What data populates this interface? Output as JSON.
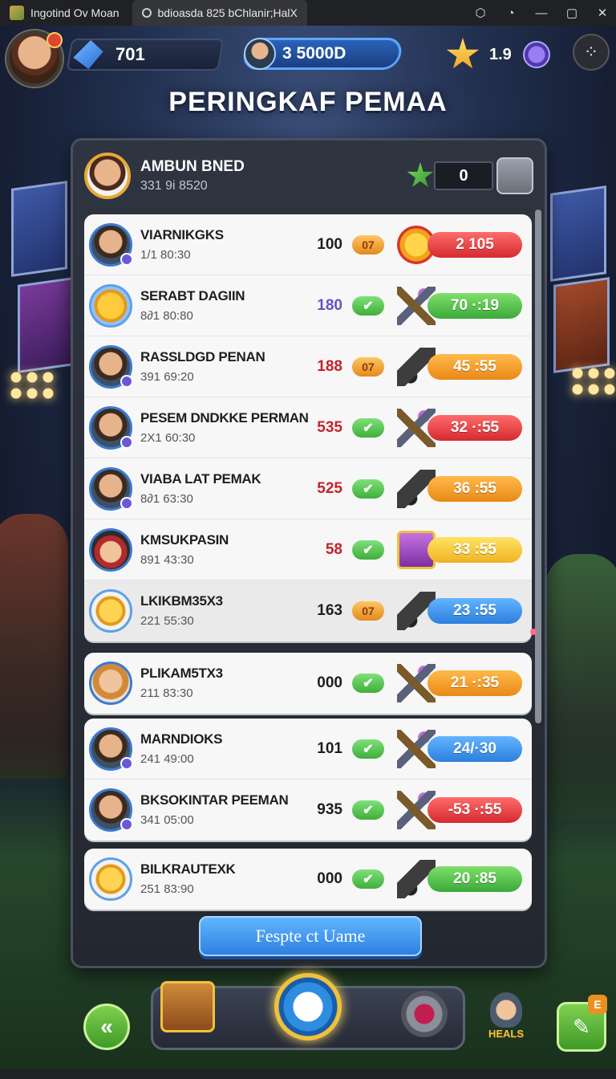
{
  "window": {
    "tabs": [
      {
        "label": "Ingotind Ov Moan"
      },
      {
        "label": "bdioasda  825  bChlanir;HalX"
      }
    ],
    "controls": [
      "⬡",
      "◔",
      "—",
      "▢",
      "✕"
    ]
  },
  "hud": {
    "gems": "701",
    "score": "3 5000D",
    "stars": "1.9"
  },
  "title": "PERINGKAF PEMAA",
  "me": {
    "name": "AMBUN BNED",
    "sub": "331 9i 8520",
    "score": "0"
  },
  "rows": [
    {
      "name": "VIARNIKGKS",
      "time": "1/1 80:30",
      "points": "100",
      "badge": "07",
      "badge_type": "orange",
      "bar": "2 105",
      "bar_color": "red",
      "item": "medal",
      "avatar": "hero"
    },
    {
      "name": "SERABT DAGIIN",
      "time": "8∂1 80:80",
      "points": "180",
      "badge": "✔",
      "badge_type": "green",
      "bar": "70 ·:19",
      "bar_color": "green",
      "item": "crossbow",
      "avatar": "coin",
      "points_color": "purple"
    },
    {
      "name": "RASSLDGD PENAN",
      "time": "391 69:20",
      "points": "188",
      "badge": "07",
      "badge_type": "orange",
      "bar": "45 :55",
      "bar_color": "orange",
      "item": "cannon",
      "avatar": "hero",
      "points_color": "red"
    },
    {
      "name": "PESEM DNDKKE PERMAN",
      "time": "2X1 60:30",
      "points": "535",
      "badge": "✔",
      "badge_type": "green",
      "bar": "32 ·:55",
      "bar_color": "red",
      "item": "crossbow",
      "avatar": "hero",
      "points_color": "red"
    },
    {
      "name": "VIABA LAT PEMAK",
      "time": "8∂1 63:30",
      "points": "525",
      "badge": "✔",
      "badge_type": "green",
      "bar": "36 :55",
      "bar_color": "orange",
      "item": "cannon",
      "avatar": "hero",
      "points_color": "red"
    },
    {
      "name": "KMSUKPASIN",
      "time": "891 43:30",
      "points": "58",
      "badge": "✔",
      "badge_type": "green",
      "bar": "33 :55",
      "bar_color": "yellow",
      "item": "chest",
      "avatar": "capped",
      "points_color": "red"
    },
    {
      "name": "LKIKBM35X3",
      "time": "221 55:30",
      "points": "163",
      "badge": "07",
      "badge_type": "orange",
      "bar": "23 :55",
      "bar_color": "blue",
      "item": "cannon",
      "avatar": "coin-plain"
    },
    {
      "name": "PLIKAM5TX3",
      "time": "211 83:30",
      "points": "000",
      "badge": "✔",
      "badge_type": "green",
      "bar": "21 ·:35",
      "bar_color": "orange",
      "item": "crossbow",
      "avatar": "girl"
    },
    {
      "name": "MARNDIOKS",
      "time": "241 49:00",
      "points": "101",
      "badge": "✔",
      "badge_type": "green",
      "bar": "24/·30",
      "bar_color": "blue",
      "item": "crossbow",
      "avatar": "hero"
    },
    {
      "name": "BKSOKINTAR PEEMAN",
      "time": "341 05:00",
      "points": "935",
      "badge": "✔",
      "badge_type": "green",
      "bar": "-53 ·:55",
      "bar_color": "red",
      "item": "crossbow",
      "avatar": "hero"
    },
    {
      "name": "BILKRAUTEXK",
      "time": "251 83:90",
      "points": "000",
      "badge": "✔",
      "badge_type": "green",
      "bar": "20 :85",
      "bar_color": "green",
      "item": "cannon",
      "avatar": "coin-plain"
    }
  ],
  "cta_label": "Fespte ct Uame",
  "nav": {
    "back": "«",
    "heals": "HEALS",
    "edit_badge": "E"
  }
}
